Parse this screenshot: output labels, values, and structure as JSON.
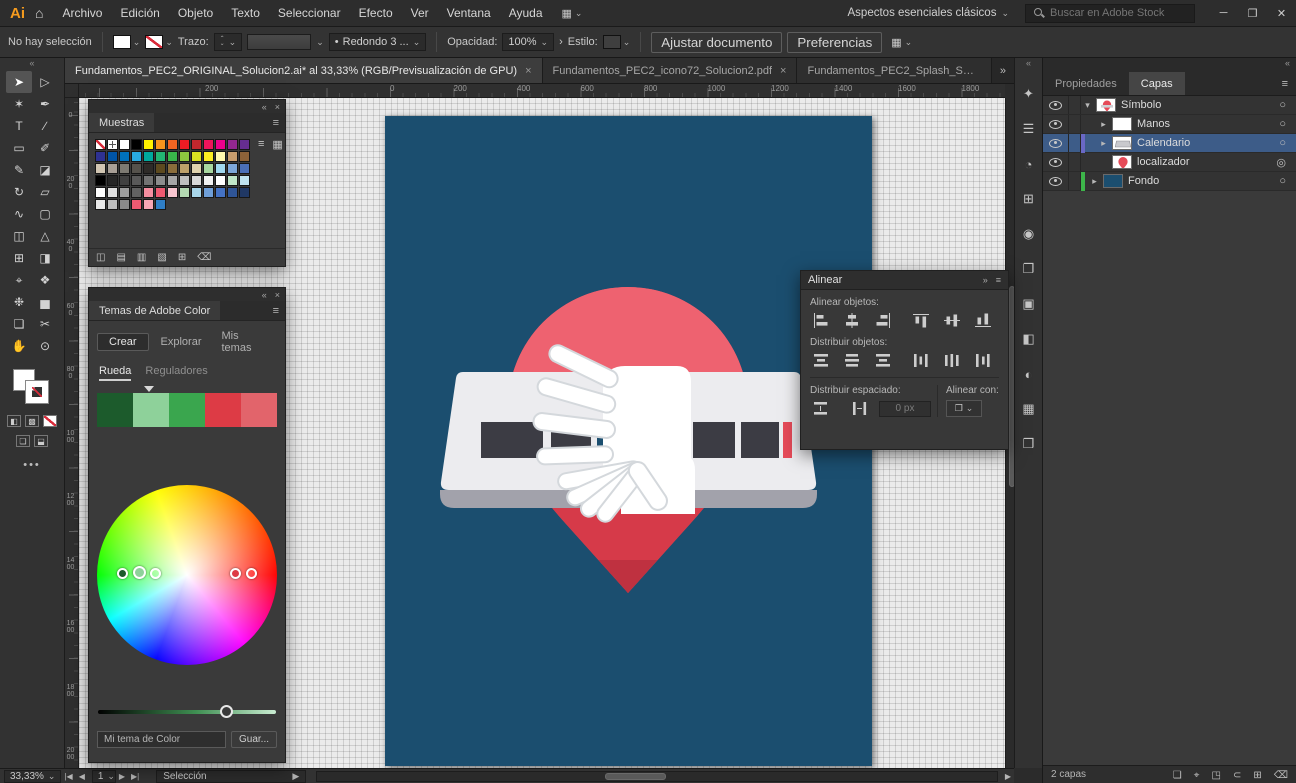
{
  "colors": {
    "artboard-blue": "#1b4e6f",
    "pin-red": "#e64b59",
    "pin-red-light": "#ee6270",
    "pin-red-dark": "#d63a49",
    "pin-red-deep": "#bf3140",
    "card-top": "#ececef",
    "card-side": "#a2a2ab",
    "glyph-dark": "#3c3c44",
    "hand-white": "#ffffff",
    "hand-line": "#d4d8dc",
    "selected-layer": "#3d5c88",
    "layer-color-green": "#3db54a",
    "layer-color-violet": "#6a68c5"
  },
  "icons": {
    "chevron_down": "⌄",
    "chevron_right": "▸",
    "expand_down": "▾",
    "collapse": "«",
    "overflow": "»",
    "close": "×",
    "menu": "≡",
    "minimize": "─",
    "restore": "❐",
    "close_window": "✕",
    "home": "⌂",
    "target": "○",
    "target_selected": "◎",
    "first": "|◀",
    "prev": "◀",
    "next": "▶",
    "last": "▶|",
    "submenu": "›",
    "dot": "•",
    "list": "≡",
    "grid": "▦",
    "up": "⌃"
  },
  "menubar": {
    "logo": "Ai",
    "items": [
      "Archivo",
      "Edición",
      "Objeto",
      "Texto",
      "Seleccionar",
      "Efecto",
      "Ver",
      "Ventana",
      "Ayuda"
    ],
    "workspace": "Aspectos esenciales clásicos",
    "search_placeholder": "Buscar en Adobe Stock"
  },
  "controlbar": {
    "selection_status": "No hay selección",
    "stroke_label": "Trazo:",
    "brush_name": "Redondo 3 ...",
    "opacity_label": "Opacidad:",
    "opacity_value": "100%",
    "style_label": "Estilo:",
    "fit_document_label": "Ajustar documento",
    "preferences_label": "Preferencias"
  },
  "document_tabs": [
    {
      "label": "Fundamentos_PEC2_ORIGINAL_Solucion2.ai* al 33,33% (RGB/Previsualización de GPU)",
      "active": true
    },
    {
      "label": "Fundamentos_PEC2_icono72_Solucion2.pdf",
      "active": false
    },
    {
      "label": "Fundamentos_PEC2_Splash_Smartphone_Solu",
      "active": false
    }
  ],
  "rulers": {
    "horizontal": [
      "200",
      "0",
      "200",
      "400",
      "600",
      "800",
      "1000",
      "1200",
      "1400",
      "1600",
      "1800"
    ],
    "vertical": [
      "0",
      "200",
      "400",
      "600",
      "800",
      "1000",
      "1200",
      "1400",
      "1600",
      "1800",
      "2000"
    ]
  },
  "toolbar": {
    "tools": [
      {
        "name": "selection-tool",
        "glyph": "➤"
      },
      {
        "name": "direct-selection-tool",
        "glyph": "▷"
      },
      {
        "name": "magic-wand-tool",
        "glyph": "✶"
      },
      {
        "name": "pen-tool",
        "glyph": "✒"
      },
      {
        "name": "type-tool",
        "glyph": "T"
      },
      {
        "name": "line-segment-tool",
        "glyph": "∕"
      },
      {
        "name": "rectangle-tool",
        "glyph": "▭"
      },
      {
        "name": "paintbrush-tool",
        "glyph": "✐"
      },
      {
        "name": "pencil-tool",
        "glyph": "✎"
      },
      {
        "name": "eraser-tool",
        "glyph": "◪"
      },
      {
        "name": "rotate-tool",
        "glyph": "↻"
      },
      {
        "name": "scale-tool",
        "glyph": "▱"
      },
      {
        "name": "width-tool",
        "glyph": "∿"
      },
      {
        "name": "free-transform-tool",
        "glyph": "▢"
      },
      {
        "name": "shape-builder-tool",
        "glyph": "◫"
      },
      {
        "name": "perspective-grid-tool",
        "glyph": "△"
      },
      {
        "name": "mesh-tool",
        "glyph": "⊞"
      },
      {
        "name": "gradient-tool",
        "glyph": "◨"
      },
      {
        "name": "eyedropper-tool",
        "glyph": "⌖"
      },
      {
        "name": "blend-tool",
        "glyph": "❖"
      },
      {
        "name": "symbol-sprayer-tool",
        "glyph": "❉"
      },
      {
        "name": "column-graph-tool",
        "glyph": "▅"
      },
      {
        "name": "artboard-tool",
        "glyph": "❏"
      },
      {
        "name": "slice-tool",
        "glyph": "✂"
      },
      {
        "name": "hand-tool",
        "glyph": "✋"
      },
      {
        "name": "zoom-tool",
        "glyph": "⊙"
      }
    ]
  },
  "swatches_panel": {
    "title": "Muestras",
    "grid": [
      [
        "none",
        "registration",
        "#ffffff",
        "#000000",
        "#fff200",
        "#f7941d",
        "#f26522",
        "#ed1c24",
        "#c1272d",
        "#ed145b",
        "#ec008c",
        "#92278f",
        "#662d91"
      ],
      [
        "#2e3192",
        "#0054a6",
        "#0071bc",
        "#29abe2",
        "#00a99d",
        "#22b573",
        "#39b54a",
        "#8cc63f",
        "#d9e021",
        "#fcee21",
        "#fff9ae",
        "#c69c6d",
        "#8c6239"
      ],
      [
        "#d1c5b2",
        "#a89f96",
        "#7d7a72",
        "#55524c",
        "#2e2b28",
        "#5d4a1f",
        "#8a6d3b",
        "#bda06a",
        "#e0d3ae",
        "#a8d79f",
        "#a0d8ef",
        "#7da7d9",
        "#4a6fb8"
      ],
      [
        "#000000",
        "#262626",
        "#404040",
        "#595959",
        "#737373",
        "#8c8c8c",
        "#a6a6a6",
        "#bfbfbf",
        "#d9d9d9",
        "#f2f2f2",
        "#ffffff",
        "#c0e6c8",
        "#bfe3f0"
      ],
      [
        "#ffffff",
        "#e0e0e0",
        "#9e9e9e",
        "#616161",
        "#f58ea0",
        "#ef5a71",
        "#f9c5cf",
        "#b4d9b2",
        "#a9d6ea",
        "#6f9fd8",
        "#4472c4",
        "#2f5597",
        "#203864"
      ],
      [
        "#e8e8e8",
        "#bdbdbd",
        "#8a8a8a",
        "#ef5a71",
        "#f7a6b4",
        "#2f7ec5"
      ]
    ],
    "footer_icons": [
      {
        "name": "swatch-libraries-icon",
        "glyph": "◫"
      },
      {
        "name": "swatch-kinds-icon",
        "glyph": "▤"
      },
      {
        "name": "swatch-options-icon",
        "glyph": "▥"
      },
      {
        "name": "new-color-group-icon",
        "glyph": "▧"
      },
      {
        "name": "new-swatch-icon",
        "glyph": "⊞"
      },
      {
        "name": "delete-swatch-icon",
        "glyph": "⌫"
      }
    ]
  },
  "color_themes_panel": {
    "title": "Temas de Adobe Color",
    "tabs": [
      "Crear",
      "Explorar",
      "Mis temas"
    ],
    "active_tab": "Crear",
    "subtabs": [
      "Rueda",
      "Reguladores"
    ],
    "active_subtab": "Rueda",
    "theme_colors": [
      "#1c5b2c",
      "#8ed19a",
      "#3aa64e",
      "#dd3b45",
      "#e2646b"
    ],
    "field_value": "Mi tema de Color",
    "save_label": "Guar...",
    "slider_pos": 0.72
  },
  "align_panel": {
    "title": "Alinear",
    "align_objects_label": "Alinear objetos:",
    "distribute_objects_label": "Distribuir objetos:",
    "distribute_spacing_label": "Distribuir espaciado:",
    "align_to_label": "Alinear con:",
    "spacing_value": "0 px"
  },
  "right_strip": {
    "icons": [
      {
        "name": "libraries-panel-icon",
        "glyph": "✦"
      },
      {
        "name": "adjustments-panel-icon",
        "glyph": "☰"
      },
      {
        "name": "color-panel-icon",
        "glyph": "◔"
      },
      {
        "name": "transform-panel-icon",
        "glyph": "⊞"
      },
      {
        "name": "gradient-panel-icon",
        "glyph": "◉"
      },
      {
        "name": "artboards-panel-icon",
        "glyph": "❐"
      },
      {
        "name": "appearance-panel-icon",
        "glyph": "▣"
      },
      {
        "name": "graphic-styles-panel-icon",
        "glyph": "◧"
      },
      {
        "name": "transparency-panel-icon",
        "glyph": "◐"
      },
      {
        "name": "symbols-panel-icon",
        "glyph": "▦"
      },
      {
        "name": "brushes-panel-icon",
        "glyph": "❒"
      }
    ]
  },
  "layers_panel": {
    "tabs": [
      "Propiedades",
      "Capas"
    ],
    "active_tab": "Capas",
    "layers": [
      {
        "name": "Símbolo"
      },
      {
        "name": "Manos"
      },
      {
        "name": "Calendario"
      },
      {
        "name": "localizador"
      },
      {
        "name": "Fondo"
      }
    ],
    "status": "2 capas",
    "footer_icons": [
      {
        "name": "collect-for-export-icon",
        "glyph": "❏"
      },
      {
        "name": "locate-object-icon",
        "glyph": "⌖"
      },
      {
        "name": "make-mask-icon",
        "glyph": "◳"
      },
      {
        "name": "new-sublayer-icon",
        "glyph": "⊂"
      },
      {
        "name": "new-layer-icon",
        "glyph": "⊞"
      },
      {
        "name": "delete-layer-icon",
        "glyph": "⌫"
      }
    ]
  },
  "statusbar": {
    "zoom": "33,33%",
    "artboard_number": "1",
    "tool_label": "Selección"
  }
}
